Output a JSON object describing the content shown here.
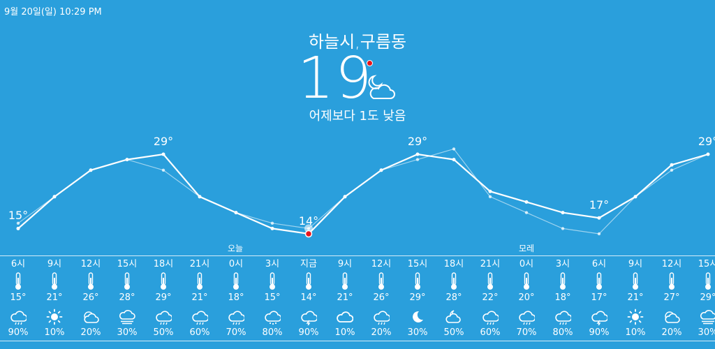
{
  "status": {
    "datetime": "9월 20일(일) 10:29 PM"
  },
  "current": {
    "location": "하늘시,구름동",
    "temperature": "19",
    "comparison": "어제보다 1도 낮음",
    "icon": "partly-cloudy-night-icon"
  },
  "day_labels": [
    "오늘",
    "모레"
  ],
  "chart_data": {
    "type": "line",
    "x": [
      "6시",
      "9시",
      "12시",
      "15시",
      "18시",
      "21시",
      "0시",
      "3시",
      "지금",
      "9시",
      "12시",
      "15시",
      "18시",
      "21시",
      "0시",
      "3시",
      "6시",
      "9시",
      "12시",
      "15시"
    ],
    "series": [
      {
        "values": [
          15,
          21,
          26,
          28,
          29,
          21,
          18,
          15,
          14,
          21,
          26,
          29,
          28,
          22,
          20,
          18,
          17,
          21,
          27,
          29
        ]
      },
      {
        "values": [
          16,
          21,
          26,
          28,
          26,
          21,
          18,
          16,
          15,
          21,
          26,
          28,
          30,
          21,
          18,
          15,
          14,
          21,
          26,
          29
        ]
      }
    ],
    "labels": [
      {
        "index": 0,
        "text": "15°"
      },
      {
        "index": 4,
        "text": "29°"
      },
      {
        "index": 8,
        "text": "14°"
      },
      {
        "index": 11,
        "text": "29°"
      },
      {
        "index": 16,
        "text": "17°"
      },
      {
        "index": 19,
        "text": "29°"
      }
    ]
  },
  "hourly": [
    {
      "time": "6시",
      "temp": "15°",
      "icon": "rain-icon",
      "pop": "90%"
    },
    {
      "time": "9시",
      "temp": "21°",
      "icon": "sun-icon",
      "pop": "10%"
    },
    {
      "time": "12시",
      "temp": "26°",
      "icon": "partly-cloudy-icon",
      "pop": "20%"
    },
    {
      "time": "15시",
      "temp": "28°",
      "icon": "fog-icon",
      "pop": "30%"
    },
    {
      "time": "18시",
      "temp": "29°",
      "icon": "rain-icon",
      "pop": "50%"
    },
    {
      "time": "21시",
      "temp": "21°",
      "icon": "rain-icon",
      "pop": "60%"
    },
    {
      "time": "0시",
      "temp": "18°",
      "icon": "rain-icon",
      "pop": "70%"
    },
    {
      "time": "3시",
      "temp": "15°",
      "icon": "snow-icon",
      "pop": "80%"
    },
    {
      "time": "지금",
      "temp": "14°",
      "icon": "thunder-icon",
      "pop": "90%"
    },
    {
      "time": "9시",
      "temp": "21°",
      "icon": "cloud-icon",
      "pop": "10%"
    },
    {
      "time": "12시",
      "temp": "26°",
      "icon": "rain-icon",
      "pop": "20%"
    },
    {
      "time": "15시",
      "temp": "29°",
      "icon": "moon-icon",
      "pop": "30%"
    },
    {
      "time": "18시",
      "temp": "28°",
      "icon": "cloud-moon-icon",
      "pop": "50%"
    },
    {
      "time": "21시",
      "temp": "22°",
      "icon": "rain-icon",
      "pop": "60%"
    },
    {
      "time": "0시",
      "temp": "20°",
      "icon": "rain-icon",
      "pop": "70%"
    },
    {
      "time": "3시",
      "temp": "18°",
      "icon": "rain-icon",
      "pop": "80%"
    },
    {
      "time": "6시",
      "temp": "17°",
      "icon": "thunder-icon",
      "pop": "90%"
    },
    {
      "time": "9시",
      "temp": "21°",
      "icon": "sun-icon",
      "pop": "10%"
    },
    {
      "time": "12시",
      "temp": "27°",
      "icon": "partly-cloudy-icon",
      "pop": "20%"
    },
    {
      "time": "15시",
      "temp": "29°",
      "icon": "fog-icon",
      "pop": "30%"
    }
  ]
}
